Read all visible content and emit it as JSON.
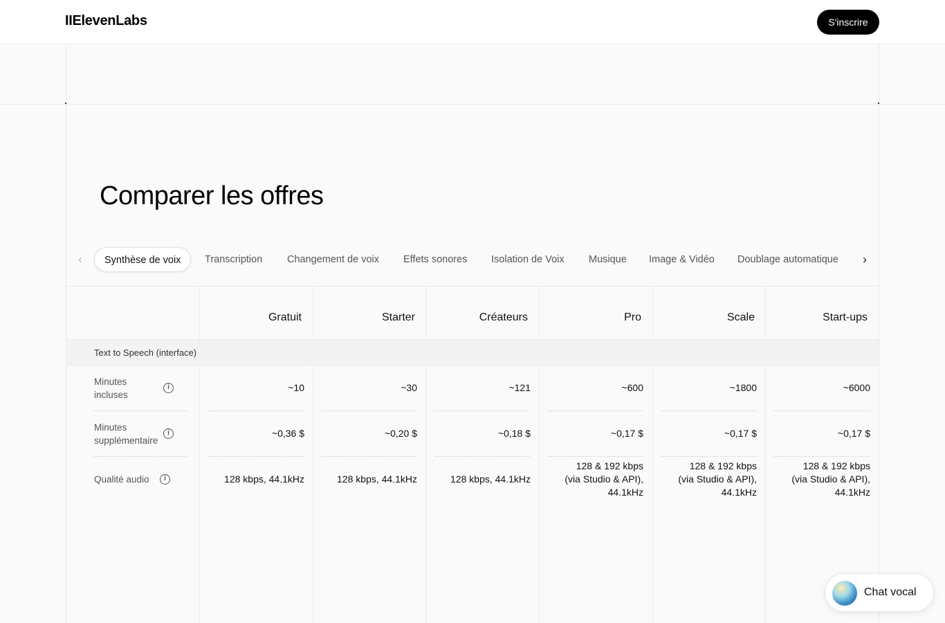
{
  "header": {
    "logo": "IIElevenLabs",
    "signup_label": "S'inscrire"
  },
  "page_title": "Comparer les offres",
  "tabs": {
    "prev_icon": "chevron-left-icon",
    "next_icon": "chevron-right-icon",
    "items": [
      {
        "label": "Synthèse de voix",
        "active": true
      },
      {
        "label": "Transcription",
        "active": false
      },
      {
        "label": "Changement de voix",
        "active": false
      },
      {
        "label": "Effets sonores",
        "active": false
      },
      {
        "label": "Isolation de Voix",
        "active": false
      },
      {
        "label": "Musique",
        "active": false
      },
      {
        "label": "Image & Vidéo",
        "active": false
      },
      {
        "label": "Doublage automatique",
        "active": false
      }
    ]
  },
  "table": {
    "plans": [
      "Gratuit",
      "Starter",
      "Créateurs",
      "Pro",
      "Scale",
      "Start-ups"
    ],
    "section": "Text to Speech (interface)",
    "rows": [
      {
        "label": "Minutes incluses",
        "values": [
          "~10",
          "~30",
          "~121",
          "~600",
          "~1800",
          "~6000"
        ]
      },
      {
        "label": "Minutes supplémentaires",
        "values": [
          "~0,36 $",
          "~0,20 $",
          "~0,18 $",
          "~0,17 $",
          "~0,17 $",
          "~0,17 $"
        ]
      },
      {
        "label": "Qualité audio",
        "values": [
          [
            "128 kbps, 44.1kHz"
          ],
          [
            "128 kbps, 44.1kHz"
          ],
          [
            "128 kbps, 44.1kHz"
          ],
          [
            "128 & 192 kbps",
            "(via Studio & API),",
            "44.1kHz"
          ],
          [
            "128 & 192 kbps",
            "(via Studio & API),",
            "44.1kHz"
          ],
          [
            "128 & 192 kbps",
            "(via Studio & API),",
            "44.1kHz"
          ]
        ]
      }
    ]
  },
  "chat_widget": {
    "label": "Chat vocal"
  }
}
